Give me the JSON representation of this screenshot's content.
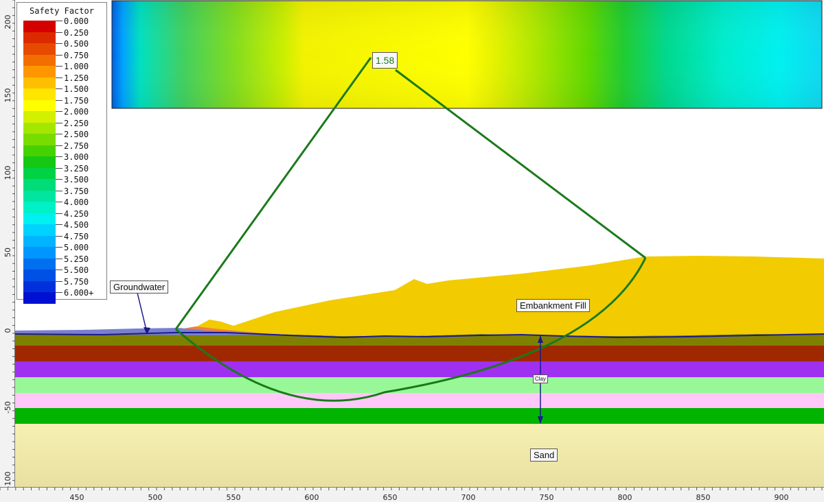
{
  "legend": {
    "title": "Safety Factor",
    "entries": [
      {
        "label": "0.000",
        "color": "#d40000"
      },
      {
        "label": "0.250",
        "color": "#dc2a00"
      },
      {
        "label": "0.500",
        "color": "#e64a00"
      },
      {
        "label": "0.750",
        "color": "#f26e00"
      },
      {
        "label": "1.000",
        "color": "#ff9600"
      },
      {
        "label": "1.250",
        "color": "#ffbe00"
      },
      {
        "label": "1.500",
        "color": "#ffe600"
      },
      {
        "label": "1.750",
        "color": "#ffff00"
      },
      {
        "label": "2.000",
        "color": "#d2f000"
      },
      {
        "label": "2.250",
        "color": "#a5e600"
      },
      {
        "label": "2.500",
        "color": "#78dc00"
      },
      {
        "label": "2.750",
        "color": "#46d200"
      },
      {
        "label": "3.000",
        "color": "#14c814"
      },
      {
        "label": "3.250",
        "color": "#00d246"
      },
      {
        "label": "3.500",
        "color": "#00dc78"
      },
      {
        "label": "3.750",
        "color": "#00e6a0"
      },
      {
        "label": "4.000",
        "color": "#00f0c8"
      },
      {
        "label": "4.250",
        "color": "#00f0f0"
      },
      {
        "label": "4.500",
        "color": "#00d2ff"
      },
      {
        "label": "4.750",
        "color": "#00b4ff"
      },
      {
        "label": "5.000",
        "color": "#0096ff"
      },
      {
        "label": "5.250",
        "color": "#0070f0"
      },
      {
        "label": "5.500",
        "color": "#0050e6"
      },
      {
        "label": "5.750",
        "color": "#0030dc"
      },
      {
        "label": "6.000+",
        "color": "#0010d2"
      }
    ]
  },
  "critical_surface": {
    "factor_of_safety": "1.58",
    "color": "#1a7a1a"
  },
  "annotations": {
    "groundwater": "Groundwater",
    "embankment_fill": "Embankment Fill",
    "clay": "Clay",
    "sand": "Sand"
  },
  "axes": {
    "x_ticks": [
      "450",
      "500",
      "550",
      "600",
      "650",
      "700",
      "750",
      "800",
      "850",
      "900"
    ],
    "y_ticks": [
      "200",
      "150",
      "100",
      "50",
      "0",
      "-50",
      "-100"
    ]
  },
  "materials": {
    "embankment_fill": "#f2cb00",
    "olive_layer": "#808000",
    "brown_layer": "#a02800",
    "purple_layer": "#a030f0",
    "light_green_layer": "#98f898",
    "pink_layer": "#ffc8f8",
    "green_layer": "#00b400",
    "sand": "#f6f0b0",
    "water_table": "#1a1a8c"
  }
}
